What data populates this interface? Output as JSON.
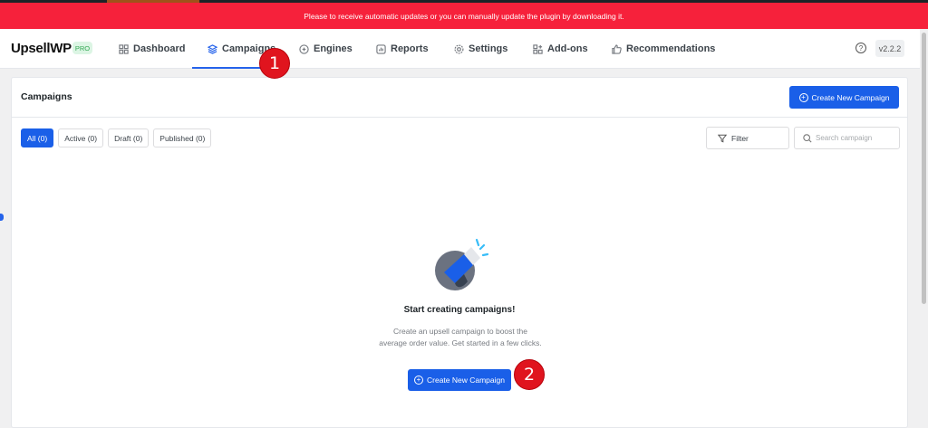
{
  "notice": {
    "text": "Please to receive automatic updates or you can manually update the plugin by downloading it."
  },
  "header": {
    "brand": "UpsellWP",
    "badge": "PRO",
    "nav": [
      {
        "label": "Dashboard",
        "icon": "dashboard-icon"
      },
      {
        "label": "Campaigns",
        "icon": "layers-icon",
        "active": true
      },
      {
        "label": "Engines",
        "icon": "engine-icon"
      },
      {
        "label": "Reports",
        "icon": "reports-icon"
      },
      {
        "label": "Settings",
        "icon": "gear-icon"
      },
      {
        "label": "Add-ons",
        "icon": "addons-icon"
      },
      {
        "label": "Recommendations",
        "icon": "thumbs-up-icon"
      }
    ],
    "help_label": "?",
    "version": "v2.2.2"
  },
  "panel": {
    "title": "Campaigns",
    "create_button": "Create New Campaign",
    "tabs": [
      {
        "label": "All (0)",
        "active": true
      },
      {
        "label": "Active (0)"
      },
      {
        "label": "Draft (0)"
      },
      {
        "label": "Published (0)"
      }
    ],
    "filter_label": "Filter",
    "search_placeholder": "Search campaign"
  },
  "empty_state": {
    "illustration": "megaphone-icon",
    "title": "Start creating campaigns!",
    "description": "Create an upsell campaign to boost the average order value. Get started in a few clicks.",
    "button": "Create New Campaign"
  },
  "markers": [
    {
      "label": "1"
    },
    {
      "label": "2"
    }
  ],
  "colors": {
    "notice": "#f6213b",
    "primary": "#1a5fe8",
    "marker": "#e0141e"
  }
}
